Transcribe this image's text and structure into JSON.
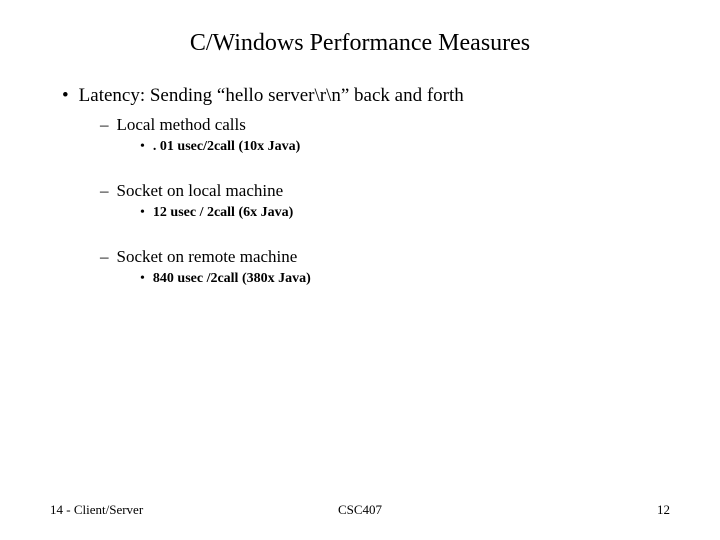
{
  "title": "C/Windows Performance Measures",
  "l1": {
    "text": "Latency: Sending “hello server\\r\\n” back and forth"
  },
  "sec1": {
    "heading": "Local method calls",
    "detail": ". 01 usec/2call (10x Java)"
  },
  "sec2": {
    "heading": "Socket on local machine",
    "detail": "12 usec / 2call (6x Java)"
  },
  "sec3": {
    "heading": "Socket on remote machine",
    "detail": "840 usec /2call (380x Java)"
  },
  "footer": {
    "left": "14 - Client/Server",
    "center": "CSC407",
    "right": "12"
  }
}
